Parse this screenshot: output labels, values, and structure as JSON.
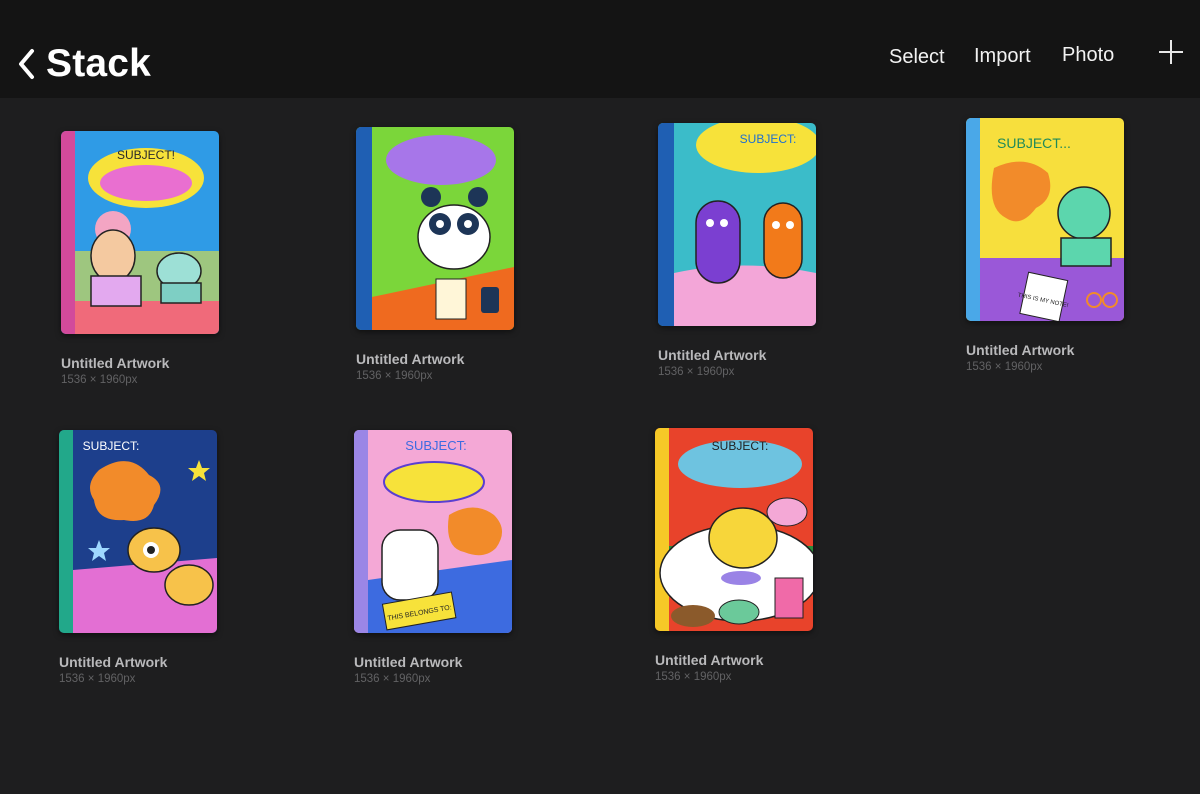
{
  "header": {
    "back_label": "Stack",
    "actions": {
      "select": "Select",
      "import": "Import",
      "photo": "Photo"
    },
    "add_icon": "plus-icon"
  },
  "artworks": [
    {
      "name": "Untitled Artwork",
      "dims": "1536 × 1960px",
      "cover_text": "SUBJECT!",
      "spine": "#d24a9b",
      "bg": "#2f9be6"
    },
    {
      "name": "Untitled Artwork",
      "dims": "1536 × 1960px",
      "cover_text": "",
      "spine": "#1f5fb3",
      "bg": "#7bd63a"
    },
    {
      "name": "Untitled Artwork",
      "dims": "1536 × 1960px",
      "cover_text": "SUBJECT:",
      "spine": "#1f5fb3",
      "bg": "#3bbcc9"
    },
    {
      "name": "Untitled Artwork",
      "dims": "1536 × 1960px",
      "cover_text": "SUBJECT...",
      "note_text": "THIS IS MY NOTE!",
      "spine": "#4aa8e8",
      "bg": "#f7df3d"
    },
    {
      "name": "Untitled Artwork",
      "dims": "1536 × 1960px",
      "cover_text": "SUBJECT:",
      "spine": "#22a88a",
      "bg": "#1d3f8c"
    },
    {
      "name": "Untitled Artwork",
      "dims": "1536 × 1960px",
      "cover_text": "SUBJECT:",
      "note_text": "THIS BELONGS TO:",
      "spine": "#9b86e6",
      "bg": "#f4a8d6"
    },
    {
      "name": "Untitled Artwork",
      "dims": "1536 × 1960px",
      "cover_text": "SUBJECT:",
      "spine": "#f6c927",
      "bg": "#e8432b"
    }
  ]
}
